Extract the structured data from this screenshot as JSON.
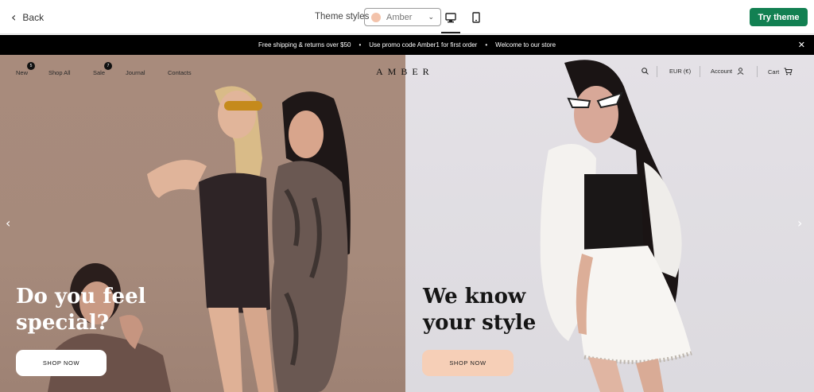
{
  "editor": {
    "back_label": "Back",
    "theme_styles_label": "Theme styles",
    "theme_style_value": "Amber",
    "theme_swatch_color": "#f3c3ab",
    "try_button_label": "Try theme",
    "try_button_color": "#128052",
    "active_device": "desktop"
  },
  "announcement": {
    "messages": [
      "Free shipping & returns over $50",
      "Use promo code Amber1 for first order",
      "Welcome to our store"
    ],
    "separator": "•"
  },
  "store_nav": {
    "logo": "AMBER",
    "items": [
      {
        "label": "New",
        "badge": "5"
      },
      {
        "label": "Shop All",
        "badge": ""
      },
      {
        "label": "Sale",
        "badge": "7"
      },
      {
        "label": "Journal",
        "badge": ""
      },
      {
        "label": "Contacts",
        "badge": ""
      }
    ],
    "currency": "EUR (€)",
    "account_label": "Account",
    "cart_label": "Cart"
  },
  "hero": {
    "left": {
      "headline_line1": "Do you feel",
      "headline_line2": "special?",
      "button_label": "SHOP NOW",
      "background": "#a88b7c"
    },
    "right": {
      "headline_line1": "We know",
      "headline_line2": "your style",
      "button_label": "SHOP NOW",
      "button_color": "#f6cfb7",
      "background": "#e2dfe4"
    }
  }
}
